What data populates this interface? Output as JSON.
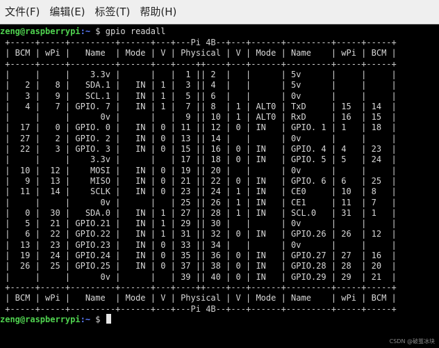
{
  "menu": [
    "文件(F)",
    "编辑(E)",
    "标签(T)",
    "帮助(H)"
  ],
  "prompt": {
    "user": "zeng@raspberrypi",
    "path": ":~",
    "symbol": " $",
    "command": " gpio readall"
  },
  "prompt2": {
    "user": "zeng@raspberrypi",
    "path": ":~",
    "symbol": " $ "
  },
  "table_lines": [
    " +-----+-----+---------+------+---+---Pi 4B--+---+------+---------+-----+-----+",
    " | BCM | wPi |   Name  | Mode | V | Physical | V | Mode | Name    | wPi | BCM |",
    " +-----+-----+---------+------+---+----++----+---+------+---------+-----+-----+",
    " |     |     |    3.3v |      |   |  1 || 2  |   |      | 5v      |     |     |",
    " |   2 |   8 |   SDA.1 |   IN | 1 |  3 || 4  |   |      | 5v      |     |     |",
    " |   3 |   9 |   SCL.1 |   IN | 1 |  5 || 6  |   |      | 0v      |     |     |",
    " |   4 |   7 | GPIO. 7 |   IN | 1 |  7 || 8  | 1 | ALT0 | TxD     | 15  | 14  |",
    " |     |     |      0v |      |   |  9 || 10 | 1 | ALT0 | RxD     | 16  | 15  |",
    " |  17 |   0 | GPIO. 0 |   IN | 0 | 11 || 12 | 0 | IN   | GPIO. 1 | 1   | 18  |",
    " |  27 |   2 | GPIO. 2 |   IN | 0 | 13 || 14 |   |      | 0v      |     |     |",
    " |  22 |   3 | GPIO. 3 |   IN | 0 | 15 || 16 | 0 | IN   | GPIO. 4 | 4   | 23  |",
    " |     |     |    3.3v |      |   | 17 || 18 | 0 | IN   | GPIO. 5 | 5   | 24  |",
    " |  10 |  12 |    MOSI |   IN | 0 | 19 || 20 |   |      | 0v      |     |     |",
    " |   9 |  13 |    MISO |   IN | 0 | 21 || 22 | 0 | IN   | GPIO. 6 | 6   | 25  |",
    " |  11 |  14 |    SCLK |   IN | 0 | 23 || 24 | 1 | IN   | CE0     | 10  | 8   |",
    " |     |     |      0v |      |   | 25 || 26 | 1 | IN   | CE1     | 11  | 7   |",
    " |   0 |  30 |   SDA.0 |   IN | 1 | 27 || 28 | 1 | IN   | SCL.0   | 31  | 1   |",
    " |   5 |  21 | GPIO.21 |   IN | 1 | 29 || 30 |   |      | 0v      |     |     |",
    " |   6 |  22 | GPIO.22 |   IN | 1 | 31 || 32 | 0 | IN   | GPIO.26 | 26  | 12  |",
    " |  13 |  23 | GPIO.23 |   IN | 0 | 33 || 34 |   |      | 0v      |     |     |",
    " |  19 |  24 | GPIO.24 |   IN | 0 | 35 || 36 | 0 | IN   | GPIO.27 | 27  | 16  |",
    " |  26 |  25 | GPIO.25 |   IN | 0 | 37 || 38 | 0 | IN   | GPIO.28 | 28  | 20  |",
    " |     |     |      0v |      |   | 39 || 40 | 0 | IN   | GPIO.29 | 29  | 21  |",
    " +-----+-----+---------+------+---+----++----+---+------+---------+-----+-----+",
    " | BCM | wPi |   Name  | Mode | V | Physical | V | Mode | Name    | wPi | BCM |",
    " +-----+-----+---------+------+---+---Pi 4B--+---+------+---------+-----+-----+"
  ],
  "watermark": "CSDN @破茧冰块"
}
